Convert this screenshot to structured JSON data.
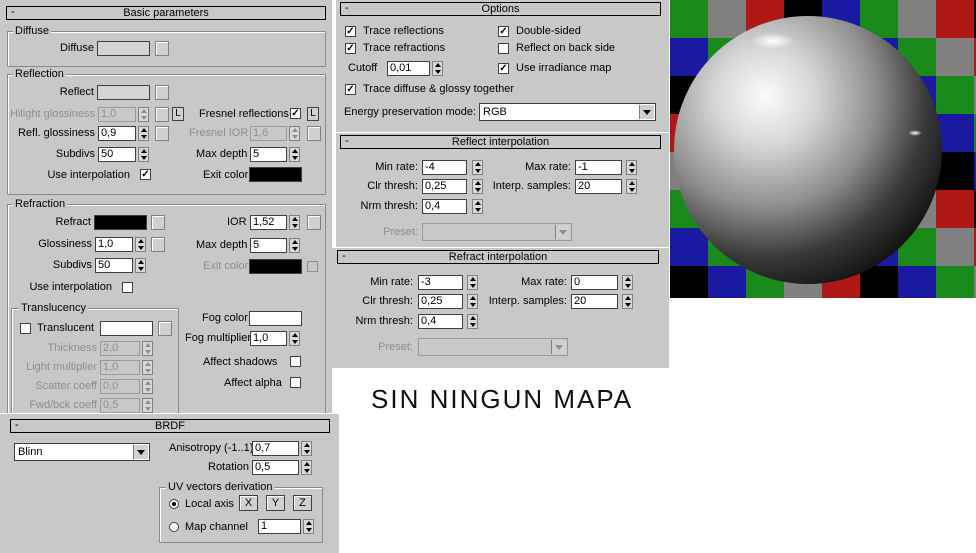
{
  "basic": {
    "title": "Basic parameters",
    "diffuse_group": "Diffuse",
    "diffuse_label": "Diffuse",
    "reflection_group": "Reflection",
    "reflect_label": "Reflect",
    "hilight_gloss_label": "Hilight glossiness",
    "hilight_gloss_value": "1,0",
    "refl_gloss_label": "Refl. glossiness",
    "refl_gloss_value": "0,9",
    "subdivs_label": "Subdivs",
    "subdivs_value": "50",
    "use_interp_label": "Use interpolation",
    "fresnel_label": "Fresnel reflections",
    "fresnel_ior_label": "Fresnel IOR",
    "fresnel_ior_value": "1,6",
    "max_depth_label": "Max depth",
    "max_depth_value": "5",
    "exit_color_label": "Exit color",
    "L": "L",
    "refraction_group": "Refraction",
    "refract_label": "Refract",
    "ior_label": "IOR",
    "ior_value": "1,52",
    "glossiness_label": "Glossiness",
    "glossiness_value": "1,0",
    "r_max_depth_label": "Max depth",
    "r_max_depth_value": "5",
    "r_subdivs_label": "Subdivs",
    "r_subdivs_value": "50",
    "r_exit_color_label": "Exit color",
    "r_use_interp_label": "Use interpolation",
    "translucency_group": "Translucency",
    "translucent_label": "Translucent",
    "thickness_label": "Thickness",
    "thickness_value": "2,0",
    "light_mult_label": "Light multiplier",
    "light_mult_value": "1,0",
    "scatter_label": "Scatter coeff",
    "scatter_value": "0,0",
    "fwdbck_label": "Fwd/bck coeff",
    "fwdbck_value": "0,5",
    "fog_color_label": "Fog color",
    "fog_mult_label": "Fog multiplier",
    "fog_mult_value": "1,0",
    "affect_shadows_label": "Affect shadows",
    "affect_alpha_label": "Affect alpha"
  },
  "brdf": {
    "title": "BRDF",
    "type_value": "Blinn",
    "anisotropy_label": "Anisotropy (-1..1)",
    "anisotropy_value": "0,7",
    "rotation_label": "Rotation",
    "rotation_value": "0,5",
    "uv_group": "UV vectors derivation",
    "local_axis_label": "Local axis",
    "x": "X",
    "y": "Y",
    "z": "Z",
    "map_channel_label": "Map channel",
    "map_channel_value": "1"
  },
  "options": {
    "title": "Options",
    "trace_reflections": "Trace reflections",
    "trace_refractions": "Trace refractions",
    "cutoff_label": "Cutoff",
    "cutoff_value": "0,01",
    "trace_diffuse": "Trace diffuse & glossy together",
    "double_sided": "Double-sided",
    "reflect_back": "Reflect on back side",
    "use_irradiance": "Use irradiance map",
    "energy_label": "Energy preservation mode:",
    "energy_value": "RGB"
  },
  "reflect_interp": {
    "title": "Reflect interpolation",
    "min_rate_label": "Min rate:",
    "min_rate_value": "-4",
    "max_rate_label": "Max rate:",
    "max_rate_value": "-1",
    "clr_label": "Clr thresh:",
    "clr_value": "0,25",
    "interp_label": "Interp. samples:",
    "interp_value": "20",
    "nrm_label": "Nrm thresh:",
    "nrm_value": "0,4",
    "preset_label": "Preset:"
  },
  "refract_interp": {
    "title": "Refract interpolation",
    "min_rate_label": "Min rate:",
    "min_rate_value": "-3",
    "max_rate_label": "Max rate:",
    "max_rate_value": "0",
    "clr_label": "Clr thresh:",
    "clr_value": "0,25",
    "interp_label": "Interp. samples:",
    "interp_value": "20",
    "nrm_label": "Nrm thresh:",
    "nrm_value": "0,4",
    "preset_label": "Preset:"
  },
  "caption": "SIN NINGUN MAPA",
  "colors": {
    "panel": "#c8c8c8",
    "diffuse_swatch": "#d4d4d4",
    "reflect_swatch": "#d4d4d4",
    "refract_swatch": "#000000",
    "exit_color": "#000000",
    "fog_color": "#ffffff",
    "translucent_swatch": "#ffffff"
  }
}
